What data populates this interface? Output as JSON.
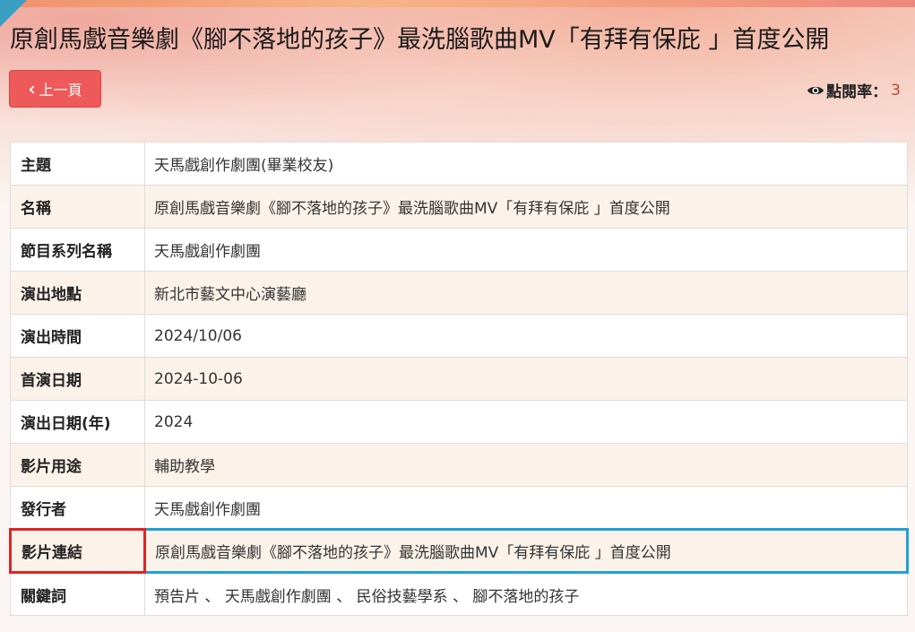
{
  "page": {
    "title": "原創馬戲音樂劇《腳不落地的孩子》最洗腦歌曲MV「有拜有保庇 」首度公開",
    "back_label": "上一頁",
    "views_label": "點閱率：",
    "views_count": "3"
  },
  "rows": [
    {
      "key": "主題",
      "value": "天馬戲創作劇團(畢業校友)"
    },
    {
      "key": "名稱",
      "value": "原創馬戲音樂劇《腳不落地的孩子》最洗腦歌曲MV「有拜有保庇 」首度公開"
    },
    {
      "key": "節目系列名稱",
      "value": "天馬戲創作劇團"
    },
    {
      "key": "演出地點",
      "value": "新北市藝文中心演藝廳"
    },
    {
      "key": "演出時間",
      "value": "2024/10/06"
    },
    {
      "key": "首演日期",
      "value": "2024-10-06"
    },
    {
      "key": "演出日期(年)",
      "value": "2024"
    },
    {
      "key": "影片用途",
      "value": "輔助教學"
    },
    {
      "key": "發行者",
      "value": "天馬戲創作劇團"
    },
    {
      "key": "影片連結",
      "value": "原創馬戲音樂劇《腳不落地的孩子》最洗腦歌曲MV「有拜有保庇 」首度公開"
    },
    {
      "key": "關鍵詞",
      "value": "預告片 、 天馬戲創作劇團 、 民俗技藝學系 、 腳不落地的孩子"
    }
  ],
  "colors": {
    "back_button": "#ee5a5a",
    "views_count": "#b8463a",
    "highlight_key": "#e02424",
    "highlight_value": "#1ea1d8"
  }
}
